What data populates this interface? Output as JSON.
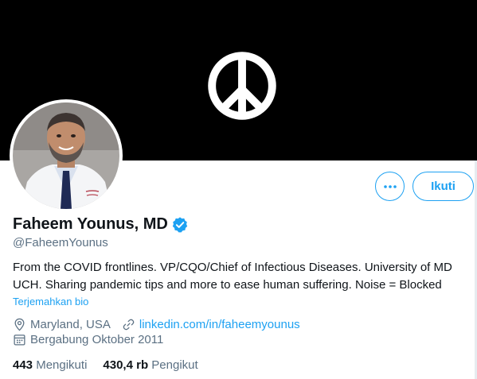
{
  "banner": {
    "icon": "peace-icon",
    "background": "#000000"
  },
  "profile": {
    "name": "Faheem Younus, MD",
    "handle": "@FaheemYounus",
    "bio_line1": "From the COVID frontlines. VP/CQO/Chief of Infectious Diseases. University of MD",
    "bio_line2": "UCH. Sharing pandemic tips and more to ease human suffering. Noise = Blocked",
    "translate_label": "Terjemahkan bio",
    "location": "Maryland, USA",
    "website": "linkedin.com/in/faheemyounus",
    "joined": "Bergabung Oktober 2011"
  },
  "actions": {
    "more_label": "•••",
    "follow_label": "Ikuti"
  },
  "stats": {
    "following_count": "443",
    "following_label": "Mengikuti",
    "followers_count": "430,4 rb",
    "followers_label": "Pengikut"
  },
  "colors": {
    "accent": "#1da1f2",
    "muted": "#5b7083",
    "text": "#0f1419"
  }
}
